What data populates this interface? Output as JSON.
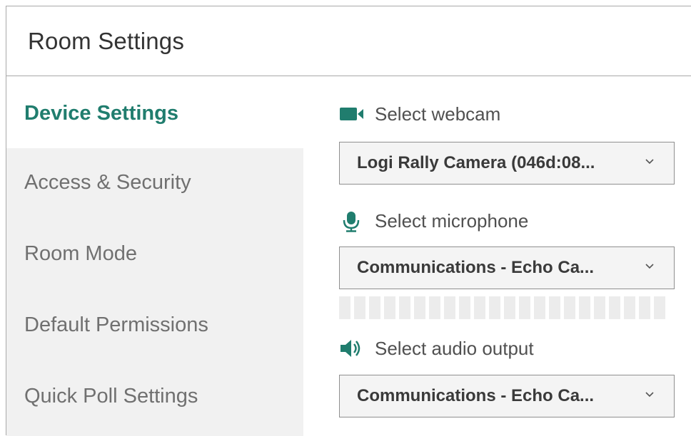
{
  "dialog": {
    "title": "Room Settings"
  },
  "sidebar": {
    "items": [
      {
        "label": "Device Settings",
        "active": true
      },
      {
        "label": "Access & Security",
        "active": false
      },
      {
        "label": "Room Mode",
        "active": false
      },
      {
        "label": "Default Permissions",
        "active": false
      },
      {
        "label": "Quick Poll Settings",
        "active": false
      }
    ]
  },
  "device_settings": {
    "webcam": {
      "label": "Select webcam",
      "icon": "video-camera-icon",
      "selected": "Logi Rally Camera (046d:08..."
    },
    "microphone": {
      "label": "Select microphone",
      "icon": "microphone-icon",
      "selected": "Communications - Echo Ca...",
      "level": 0
    },
    "audio_output": {
      "label": "Select audio output",
      "icon": "speaker-icon",
      "selected": "Communications - Echo Ca..."
    }
  },
  "colors": {
    "accent": "#207d6e",
    "sidebar_bg": "#f1f1f1",
    "select_bg": "#f4f4f4",
    "meter_idle": "#ececec"
  }
}
